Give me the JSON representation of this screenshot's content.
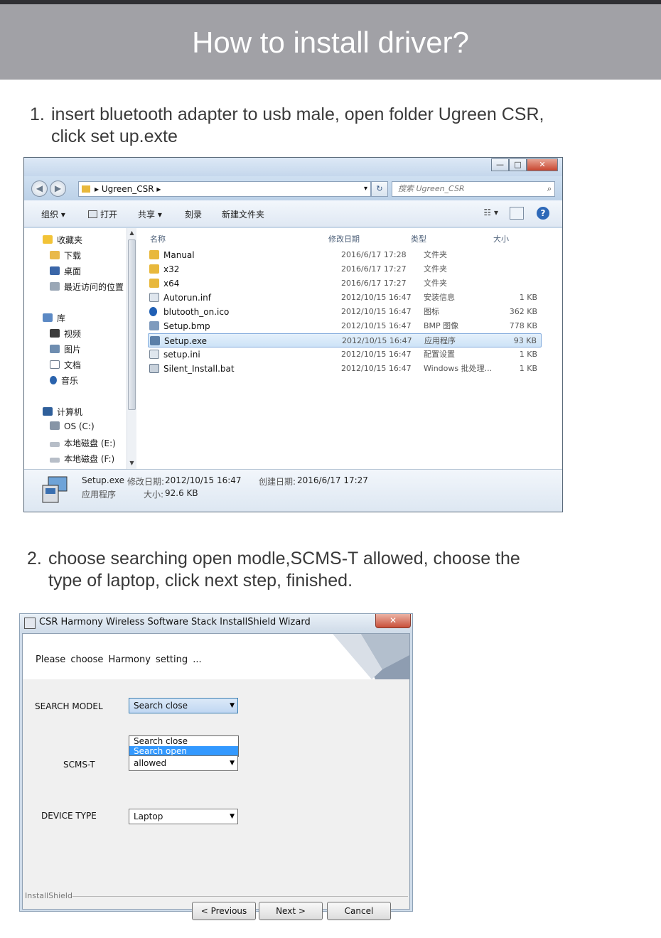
{
  "banner": {
    "title": "How to install driver?"
  },
  "step1": {
    "number": "1.",
    "text": "insert bluetooth adapter to usb male, open folder Ugreen CSR,\nclick set up.exte"
  },
  "step2": {
    "number": "2.",
    "text": "choose searching open modle,SCMS-T allowed, choose the\ntype of laptop, click next step, finished."
  },
  "explorer": {
    "window_buttons": {
      "minimize": "—",
      "maximize": "□",
      "close": "✕"
    },
    "back": "◀",
    "forward": "▶",
    "address": "▸  Ugreen_CSR  ▸",
    "address_dropdown": "▾",
    "refresh": "↻",
    "search_placeholder": "搜索 Ugreen_CSR",
    "search_icon": "search-icon",
    "toolbar": {
      "organize": "组织 ▾",
      "open": "打开",
      "share": "共享 ▾",
      "burn": "刻录",
      "new_folder": "新建文件夹",
      "view": "☷ ▾",
      "help": "?"
    },
    "nav": {
      "favorites": "收藏夹",
      "downloads": "下载",
      "desktop": "桌面",
      "recent": "最近访问的位置",
      "libraries": "库",
      "videos": "视频",
      "pictures": "图片",
      "documents": "文档",
      "music": "音乐",
      "computer": "计算机",
      "drive_c": "OS (C:)",
      "drive_e": "本地磁盘 (E:)",
      "drive_f": "本地磁盘 (F:)"
    },
    "columns": {
      "name": "名称",
      "modified": "修改日期",
      "type": "类型",
      "size": "大小"
    },
    "files": [
      {
        "name": "Manual",
        "date": "2016/6/17 17:28",
        "type": "文件夹",
        "size": ""
      },
      {
        "name": "x32",
        "date": "2016/6/17 17:27",
        "type": "文件夹",
        "size": ""
      },
      {
        "name": "x64",
        "date": "2016/6/17 17:27",
        "type": "文件夹",
        "size": ""
      },
      {
        "name": "Autorun.inf",
        "date": "2012/10/15 16:47",
        "type": "安装信息",
        "size": "1 KB"
      },
      {
        "name": "blutooth_on.ico",
        "date": "2012/10/15 16:47",
        "type": "图标",
        "size": "362 KB"
      },
      {
        "name": "Setup.bmp",
        "date": "2012/10/15 16:47",
        "type": "BMP 图像",
        "size": "778 KB"
      },
      {
        "name": "Setup.exe",
        "date": "2012/10/15 16:47",
        "type": "应用程序",
        "size": "93 KB"
      },
      {
        "name": "setup.ini",
        "date": "2012/10/15 16:47",
        "type": "配置设置",
        "size": "1 KB"
      },
      {
        "name": "Silent_Install.bat",
        "date": "2012/10/15 16:47",
        "type": "Windows 批处理...",
        "size": "1 KB"
      }
    ],
    "details": {
      "filename": "Setup.exe",
      "modified_label": "修改日期:",
      "modified": "2012/10/15 16:47",
      "created_label": "创建日期:",
      "created": "2016/6/17 17:27",
      "type": "应用程序",
      "size_label": "大小:",
      "size": "92.6 KB"
    },
    "colors": {
      "frame": "#c6d8ec",
      "selection": "#cde3f7"
    }
  },
  "dialog": {
    "title": "CSR Harmony Wireless Software Stack InstallShield Wizard",
    "close": "✕",
    "header": "Please  choose  Harmony setting ...",
    "search_model_label": "SEARCH MODEL",
    "search_model_value": "Search close",
    "search_model_options": [
      "Search close",
      "Search open"
    ],
    "scms_label": "SCMS-T",
    "scms_value": "allowed",
    "device_label": "DEVICE TYPE",
    "device_value": "Laptop",
    "dropdown_arrow": "▼",
    "installshield": "InstallShield",
    "buttons": {
      "previous": "< Previous",
      "next": "Next   >",
      "cancel": "Cancel"
    },
    "colors": {
      "highlight": "#3399ff"
    }
  }
}
